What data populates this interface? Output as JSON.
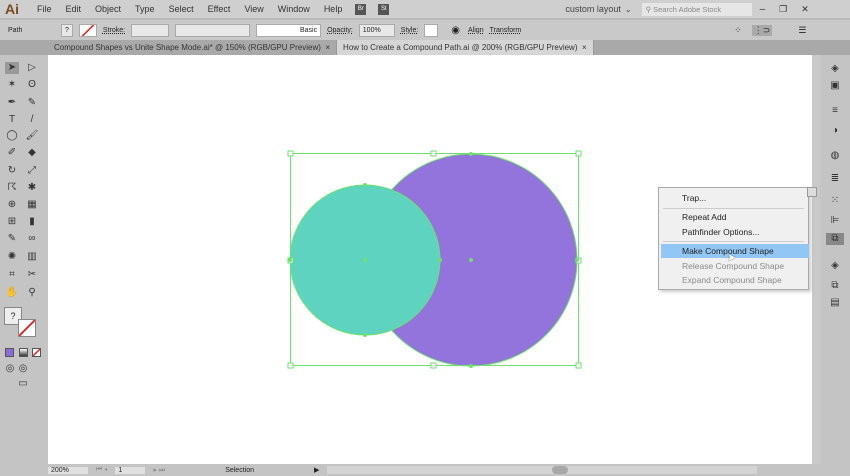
{
  "app": {
    "logo": "Ai"
  },
  "menubar": {
    "items": [
      "File",
      "Edit",
      "Object",
      "Type",
      "Select",
      "Effect",
      "View",
      "Window",
      "Help"
    ],
    "bridge": "Br",
    "stock": "St",
    "workspace": "custom layout",
    "search_placeholder": "Search Adobe Stock"
  },
  "control": {
    "selection_type": "Path",
    "fill": "?",
    "stroke_label": "Stroke:",
    "brush": "Basic",
    "opacity_label": "Opacity:",
    "opacity": "100%",
    "style_label": "Style:",
    "align": "Align",
    "transform": "Transform"
  },
  "tabs": [
    {
      "label": "Compound Shapes vs Unite Shape Mode.ai* @ 150% (RGB/GPU Preview)",
      "close": "×"
    },
    {
      "label": "How to Create a Compound Path.ai @ 200% (RGB/GPU Preview)",
      "close": "×"
    }
  ],
  "context_menu": {
    "items": [
      {
        "label": "Trap...",
        "enabled": true
      },
      {
        "label": "Repeat Add",
        "enabled": true
      },
      {
        "label": "Pathfinder Options...",
        "enabled": true
      },
      {
        "label": "Make Compound Shape",
        "enabled": true,
        "highlighted": true
      },
      {
        "label": "Release Compound Shape",
        "enabled": false
      },
      {
        "label": "Expand Compound Shape",
        "enabled": false
      }
    ]
  },
  "status": {
    "zoom": "200%",
    "artboard": "1",
    "tool": "Selection"
  },
  "colors": {
    "teal": "#5dd3c0",
    "purple": "#9274dc",
    "selection": "#6ee06e",
    "highlight": "#91c6f5"
  }
}
